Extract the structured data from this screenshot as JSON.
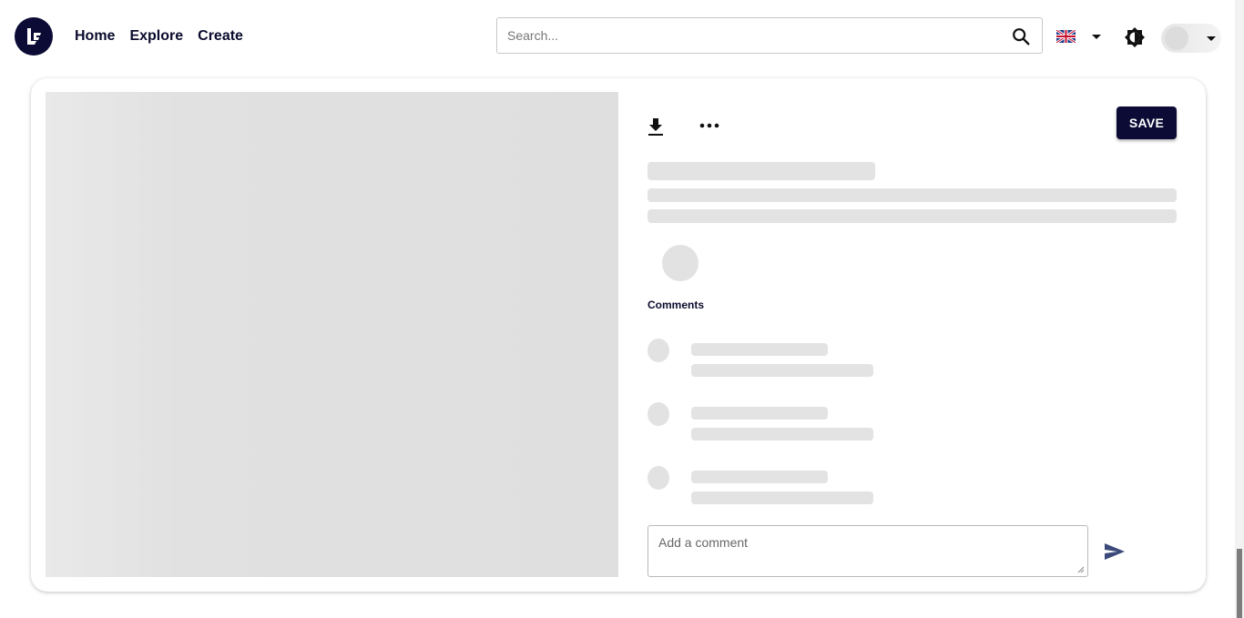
{
  "nav": {
    "home": "Home",
    "explore": "Explore",
    "create": "Create"
  },
  "search": {
    "placeholder": "Search..."
  },
  "post": {
    "save_label": "SAVE",
    "comments_heading": "Comments",
    "comment_placeholder": "Add a comment"
  },
  "icons": {
    "logo": "logo-icon",
    "search": "search-icon",
    "language": "uk-flag-icon",
    "theme": "brightness-icon",
    "download": "download-icon",
    "more": "more-horizontal-icon",
    "send": "send-icon"
  },
  "colors": {
    "brand": "#0b0b35",
    "skeleton": "#e3e3e3",
    "send": "#3b4a7a"
  }
}
